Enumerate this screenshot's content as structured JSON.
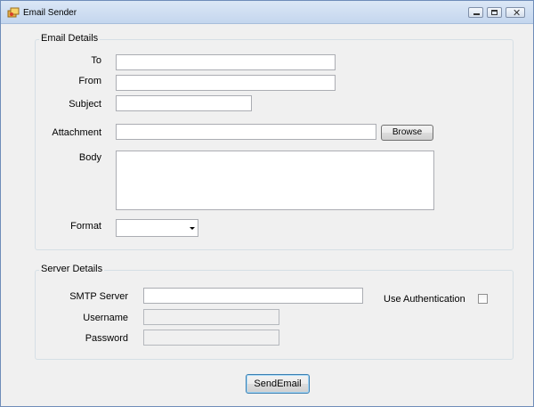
{
  "window": {
    "title": "Email Sender"
  },
  "email_group": {
    "title": "Email Details",
    "to_label": "To",
    "from_label": "From",
    "subject_label": "Subject",
    "attachment_label": "Attachment",
    "browse_label": "Browse",
    "body_label": "Body",
    "format_label": "Format"
  },
  "server_group": {
    "title": "Server Details",
    "smtp_label": "SMTP Server",
    "username_label": "Username",
    "password_label": "Password",
    "use_auth_label": "Use Authentication"
  },
  "send_label": "SendEmail"
}
